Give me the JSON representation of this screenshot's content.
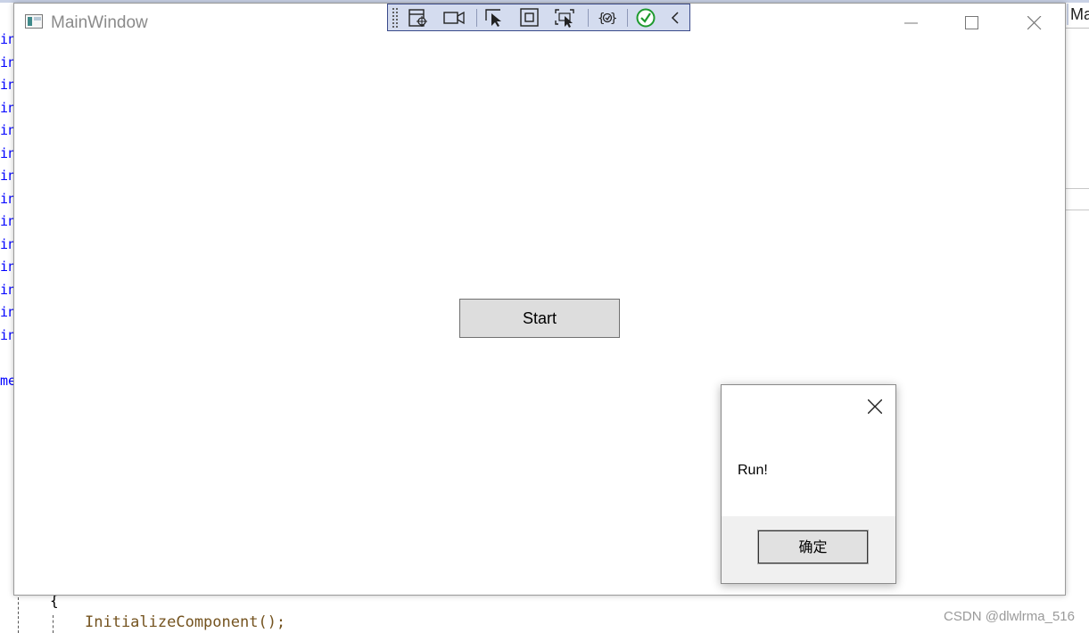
{
  "ide": {
    "right_tab_label": "Ma",
    "gutter_fragments": [
      "in",
      "in",
      "in",
      "in",
      "in",
      "in",
      "in",
      "in",
      "in",
      "in",
      "in",
      "in",
      "in",
      "in",
      "me"
    ],
    "code_brace": "{",
    "code_line": "InitializeComponent();"
  },
  "watermark": "CSDN @dlwlrma_516",
  "main_window": {
    "title": "MainWindow",
    "start_button_label": "Start"
  },
  "debug_toolbar": {
    "icons": [
      "select-element-icon",
      "record-icon",
      "pointer-select-icon",
      "layout-adorner-icon",
      "track-focus-icon",
      "binding-failures-icon",
      "hot-reload-ok-icon",
      "collapse-chevron-icon"
    ]
  },
  "message_box": {
    "text": "Run!",
    "ok_label": "确定"
  },
  "colors": {
    "toolbar_bg": "#d4dcef",
    "toolbar_border": "#3a4a8a",
    "button_bg": "#dddddd",
    "hot_reload_ok": "#1e9a2e",
    "code_keyword": "#0000ff",
    "code_method": "#74531f"
  }
}
